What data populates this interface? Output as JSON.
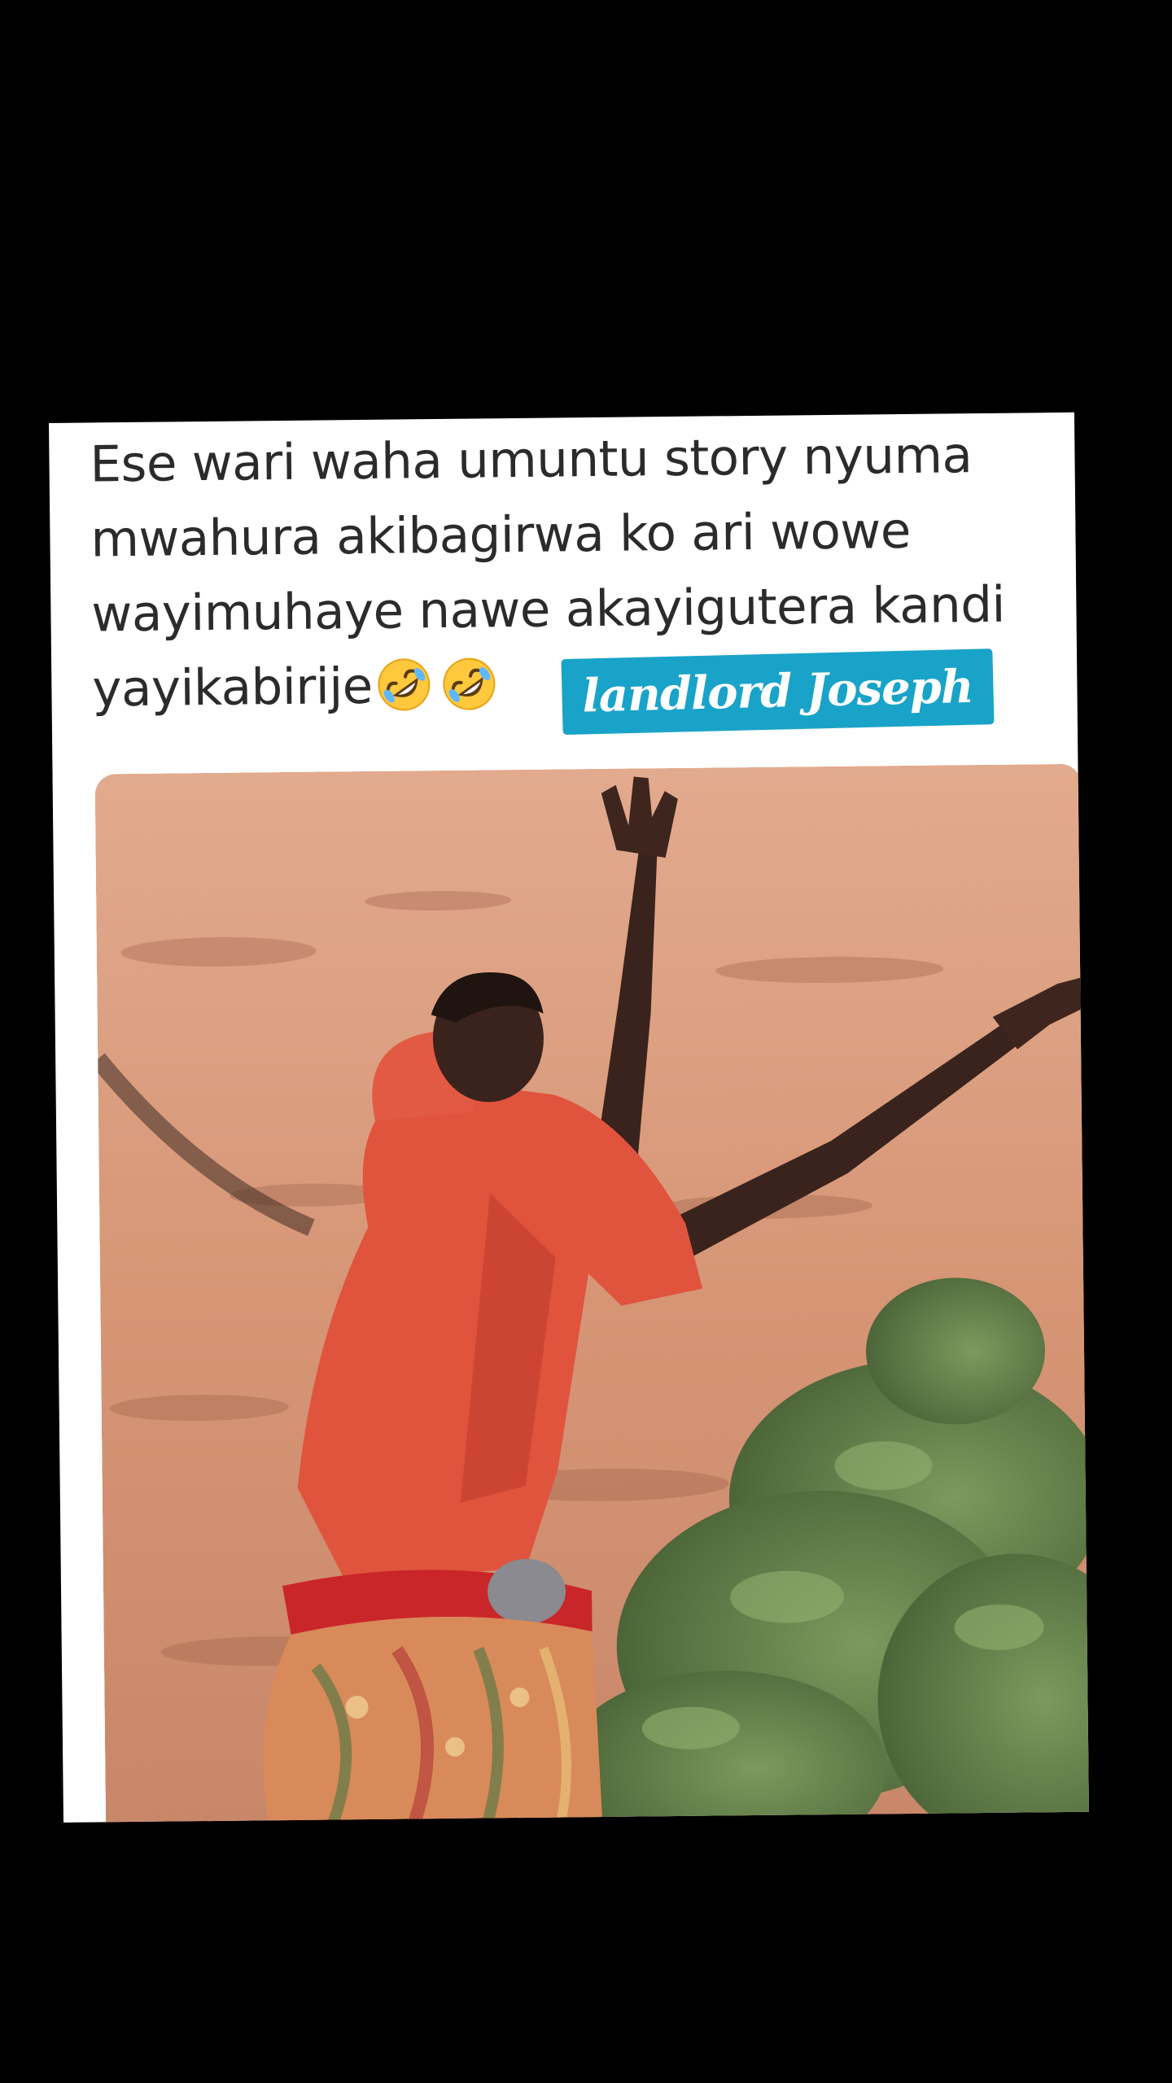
{
  "post": {
    "text": "Ese wari waha umuntu story nyuma\nmwahura  akibagirwa ko ari wowe\nwayimuhaye nawe akayigutera kandi\nyayikabirije",
    "emojis": [
      "rolling-on-floor-laughing-emoji",
      "rolling-on-floor-laughing-emoji"
    ]
  },
  "watermark": {
    "label": "landlord Joseph",
    "background": "#1aa3c8"
  },
  "photo": {
    "subject": "person-in-red-clothing-raising-arms",
    "colors": {
      "ground": "#d99a7c",
      "clothing": "#e0533d",
      "skin": "#3a231c",
      "foliage": "#5f7a48"
    }
  },
  "colors": {
    "page_background": "#000000",
    "card_background": "#ffffff",
    "text": "#2b2b2b"
  }
}
